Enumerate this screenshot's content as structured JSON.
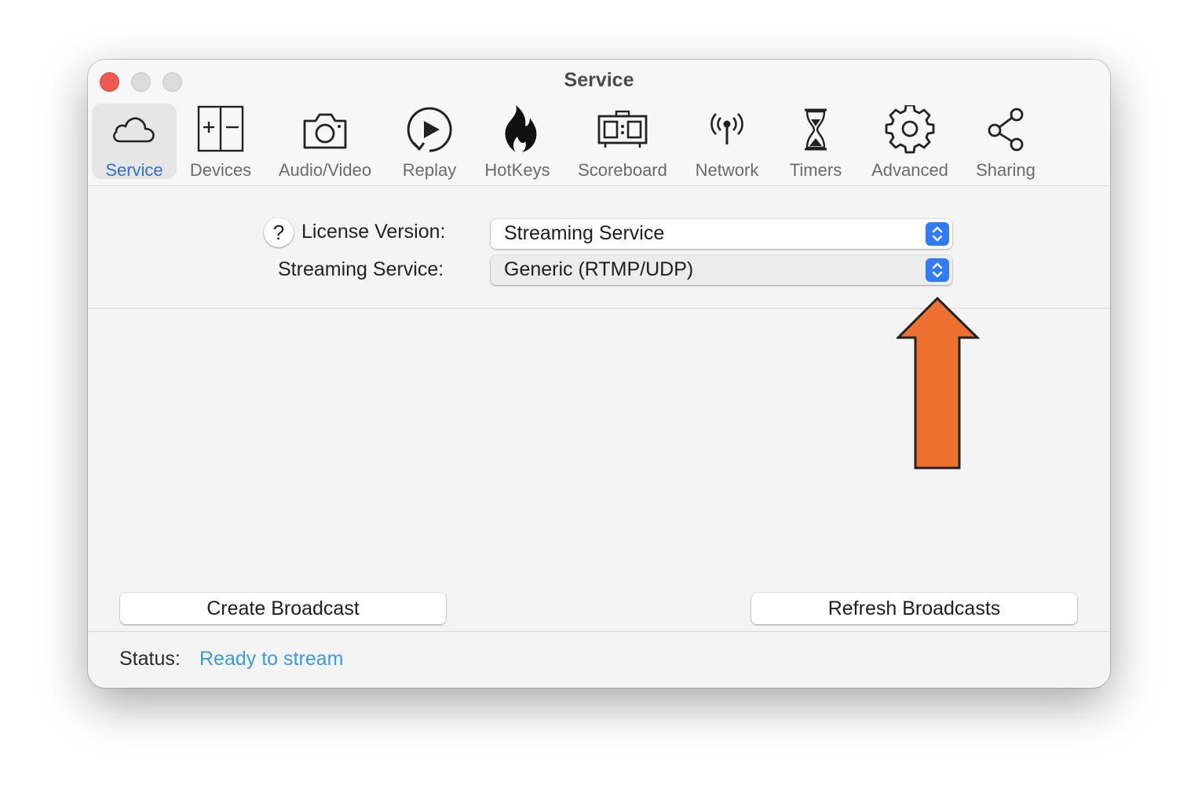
{
  "window": {
    "title": "Service"
  },
  "toolbar": {
    "items": [
      {
        "label": "Service",
        "icon": "cloud-icon",
        "selected": true
      },
      {
        "label": "Devices",
        "icon": "devices-icon",
        "selected": false
      },
      {
        "label": "Audio/Video",
        "icon": "camera-icon",
        "selected": false
      },
      {
        "label": "Replay",
        "icon": "replay-icon",
        "selected": false
      },
      {
        "label": "HotKeys",
        "icon": "flame-icon",
        "selected": false
      },
      {
        "label": "Scoreboard",
        "icon": "scoreboard-icon",
        "selected": false
      },
      {
        "label": "Network",
        "icon": "antenna-icon",
        "selected": false
      },
      {
        "label": "Timers",
        "icon": "hourglass-icon",
        "selected": false
      },
      {
        "label": "Advanced",
        "icon": "gear-icon",
        "selected": false
      },
      {
        "label": "Sharing",
        "icon": "share-icon",
        "selected": false
      }
    ]
  },
  "form": {
    "help_label": "?",
    "license_label": "License Version:",
    "license_value": "Streaming Service",
    "service_label": "Streaming Service:",
    "service_value": "Generic (RTMP/UDP)"
  },
  "annotation": {
    "arrow_color": "#ee7030"
  },
  "buttons": {
    "create": "Create Broadcast",
    "refresh": "Refresh Broadcasts"
  },
  "status": {
    "label": "Status:",
    "value": "Ready to stream",
    "value_color": "#3a9bd9"
  },
  "colors": {
    "accent": "#2f7cf6",
    "selected_tab_text": "#2f6fd6",
    "close_button": "#ee5a52"
  }
}
